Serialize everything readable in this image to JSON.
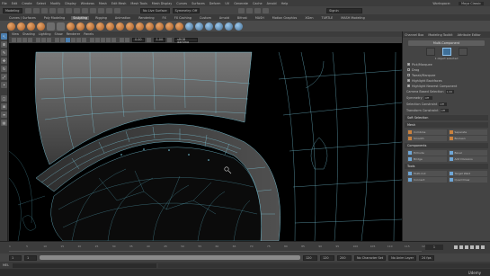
{
  "menubar": {
    "items": [
      "File",
      "Edit",
      "Create",
      "Select",
      "Modify",
      "Display",
      "Windows",
      "Mesh",
      "Edit Mesh",
      "Mesh Tools",
      "Mesh Display",
      "Curves",
      "Surfaces",
      "Deform",
      "UV",
      "Generate",
      "Cache",
      "Arnold",
      "Help"
    ],
    "workspace_label": "Workspace:",
    "workspace_value": "Maya Classic"
  },
  "statusline": {
    "mode": "Modeling",
    "live_surface": "No Live Surface",
    "symmetry": "Symmetry: Off",
    "user": "Signin"
  },
  "shelf": {
    "tabs": [
      "Curves / Surfaces",
      "Poly Modeling",
      "Sculpting",
      "Rigging",
      "Animation",
      "Rendering",
      "FX",
      "FX Caching",
      "Custom",
      "Arnold",
      "Bifrost",
      "MASH",
      "Motion Graphics",
      "XGen",
      "TURTLE",
      "MASH Modeling"
    ],
    "active_tab": "Sculpting",
    "icons": [
      "sphere",
      "sphere",
      "sphere",
      "sphere",
      "cube",
      "cube",
      "sphere",
      "sphere",
      "sphere",
      "sphere",
      "sphere",
      "sphere",
      "sphere",
      "sphere",
      "sphere",
      "sphere",
      "sphere",
      "sphere",
      "sphere",
      "sphere",
      "sphere",
      "sphere",
      "sphere",
      "sphere"
    ]
  },
  "toolbox": {
    "tools": [
      "select-tool",
      "lasso-tool",
      "paint-select-tool",
      "move-tool",
      "rotate-tool",
      "scale-tool",
      "last-tool"
    ]
  },
  "viewport": {
    "menu": [
      "View",
      "Shading",
      "Lighting",
      "Show",
      "Renderer",
      "Panels"
    ],
    "field_1": "0.00",
    "field_2": "1.00",
    "color_space": "sRGB gamma"
  },
  "modeling_toolkit": {
    "tabs": [
      "Channel Box",
      "Modeling Toolkit",
      "Attribute Editor"
    ],
    "header": "Multi-Component",
    "icon_caption": "1 object selected",
    "checks": [
      {
        "label": "Pick/Marquee",
        "on": true
      },
      {
        "label": "Drag",
        "on": false
      },
      {
        "label": "Tweak/Marquee",
        "on": false
      },
      {
        "label": "Highlight Backfaces",
        "on": true
      },
      {
        "label": "Highlight Nearest Component",
        "on": true
      }
    ],
    "numbers": [
      {
        "label": "Camera Based Selection",
        "value": "1.00"
      },
      {
        "label": "Symmetry",
        "value": "Off"
      },
      {
        "label": "Selection Constraint",
        "value": "Off"
      },
      {
        "label": "Transform Constraint",
        "value": "Off"
      }
    ],
    "soft_selection": "Soft Selection",
    "mesh_header": "Mesh",
    "mesh_tools": [
      "Combine",
      "Separate",
      "Smooth",
      "Boolean"
    ],
    "components_header": "Components",
    "component_tools": [
      "Extrude",
      "Bevel",
      "Bridge",
      "Add Divisions"
    ],
    "tools_header": "Tools",
    "tools": [
      "Multi-Cut",
      "Target Weld",
      "Connect",
      "Quad Draw"
    ],
    "accent": "#4b7fb0"
  },
  "timeslider": {
    "ticks": [
      "1",
      "5",
      "10",
      "15",
      "20",
      "25",
      "30",
      "35",
      "40",
      "45",
      "50",
      "55",
      "60",
      "65",
      "70",
      "75",
      "80",
      "85",
      "90",
      "95",
      "100",
      "105",
      "110",
      "115",
      "120"
    ],
    "current_frame": "1"
  },
  "range": {
    "start": "1",
    "range_start": "1",
    "range_end": "120",
    "end": "120",
    "anim_end": "200",
    "character_set": "No Character Set",
    "anim_layer": "No Anim Layer",
    "fps": "24 fps"
  },
  "cmdline": {
    "lang": "MEL"
  },
  "helpline": {
    "watermark": "Udemy"
  }
}
